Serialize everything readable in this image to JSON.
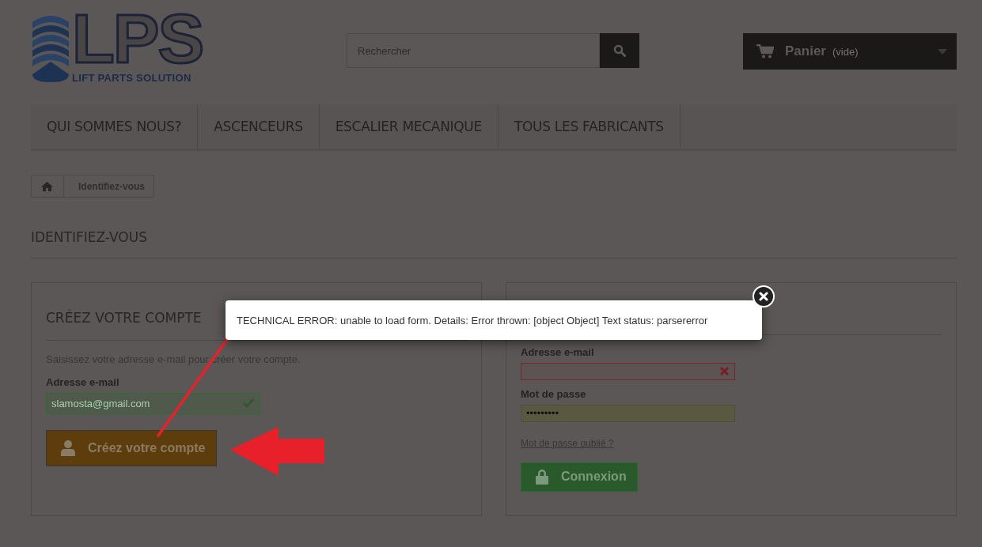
{
  "logo": {
    "letters": "LPS",
    "tagline": "LIFT PARTS SOLUTION"
  },
  "search": {
    "placeholder": "Rechercher"
  },
  "cart": {
    "label": "Panier",
    "status": "(vide)"
  },
  "nav": {
    "items": [
      {
        "label": "QUI SOMMES NOUS?"
      },
      {
        "label": "ASCENCEURS"
      },
      {
        "label": "ESCALIER MECANIQUE"
      },
      {
        "label": "TOUS LES FABRICANTS"
      }
    ]
  },
  "breadcrumb": {
    "current": "Identifiez-vous"
  },
  "page_title": "IDENTIFIEZ-VOUS",
  "create_account": {
    "title": "CRÉEZ VOTRE COMPTE",
    "intro": "Saisissez votre adresse e-mail pour créer votre compte.",
    "fields": [
      {
        "label": "Adresse e-mail",
        "value": "slamosta@gmail.com",
        "kind": "valid"
      }
    ],
    "button": "Créez votre compte"
  },
  "login": {
    "fields": [
      {
        "label": "Adresse e-mail",
        "kind": "invalid"
      },
      {
        "label": "Mot de passe",
        "value": "•••••••••",
        "kind": "autofill"
      }
    ],
    "forgot_link": "Mot de passe oublié ?",
    "button": "Connexion"
  },
  "error_popup": {
    "message": "TECHNICAL ERROR: unable to load form. Details: Error thrown: [object Object] Text status: parsererror"
  }
}
